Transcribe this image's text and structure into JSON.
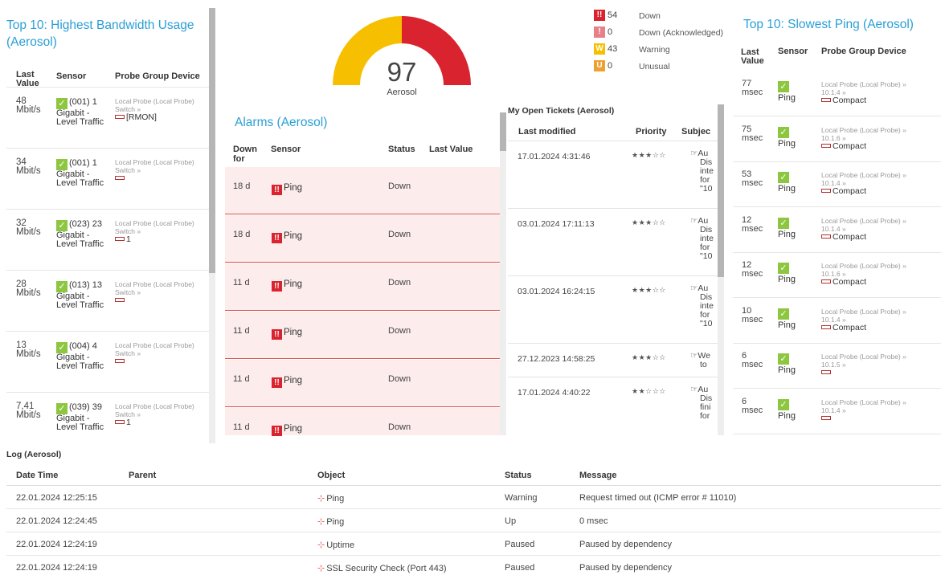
{
  "bandwidth": {
    "title": "Top 10: Highest Bandwidth Usage (Aerosol)",
    "headers": {
      "value": "Last Value",
      "sensor": "Sensor",
      "device": "Probe Group Device"
    },
    "rows": [
      {
        "value": "48 Mbit/s",
        "sensor": "(001) 1 Gigabit - Level Traffic",
        "probe": "Local Probe (Local Probe)",
        "group": "Switch »",
        "device": "[RMON]"
      },
      {
        "value": "34 Mbit/s",
        "sensor": "(001) 1 Gigabit - Level Traffic",
        "probe": "Local Probe (Local Probe)",
        "group": "Switch »",
        "device": ""
      },
      {
        "value": "32 Mbit/s",
        "sensor": "(023) 23 Gigabit - Level Traffic",
        "probe": "Local Probe (Local Probe)",
        "group": "Switch »",
        "device": "1"
      },
      {
        "value": "28 Mbit/s",
        "sensor": "(013) 13 Gigabit - Level Traffic",
        "probe": "Local Probe (Local Probe)",
        "group": "Switch »",
        "device": ""
      },
      {
        "value": "13 Mbit/s",
        "sensor": "(004) 4 Gigabit - Level Traffic",
        "probe": "Local Probe (Local Probe)",
        "group": "Switch »",
        "device": ""
      },
      {
        "value": "7,41 Mbit/s",
        "sensor": "(039) 39 Gigabit - Level Traffic",
        "probe": "Local Probe (Local Probe)",
        "group": "Switch »",
        "device": "1"
      }
    ]
  },
  "gauge": {
    "value": "97",
    "label": "Aerosol",
    "fraction": 0.5,
    "colors": {
      "warn": "#f6c000",
      "down": "#d9232e"
    }
  },
  "status": [
    {
      "glyph": "!!",
      "count": "54",
      "label": "Down",
      "color": "#d9232e"
    },
    {
      "glyph": "!",
      "count": "0",
      "label": "Down (Acknowledged)",
      "color": "#e8808a"
    },
    {
      "glyph": "W",
      "count": "43",
      "label": "Warning",
      "color": "#f6c000"
    },
    {
      "glyph": "U",
      "count": "0",
      "label": "Unusual",
      "color": "#f0a030"
    }
  ],
  "alarms": {
    "title": "Alarms (Aerosol)",
    "headers": {
      "down": "Down for",
      "sensor": "Sensor",
      "status": "Status",
      "last": "Last Value"
    },
    "rows": [
      {
        "down": "18 d",
        "sensor": "Ping",
        "status": "Down"
      },
      {
        "down": "18 d",
        "sensor": "Ping",
        "status": "Down"
      },
      {
        "down": "11 d",
        "sensor": "Ping",
        "status": "Down"
      },
      {
        "down": "11 d",
        "sensor": "Ping",
        "status": "Down"
      },
      {
        "down": "11 d",
        "sensor": "Ping",
        "status": "Down"
      },
      {
        "down": "11 d",
        "sensor": "Ping",
        "status": "Down"
      }
    ]
  },
  "tickets": {
    "title": "My Open Tickets (Aerosol)",
    "headers": {
      "modified": "Last modified",
      "priority": "Priority",
      "subject": "Subjec"
    },
    "rows": [
      {
        "modified": "17.01.2024 4:31:46",
        "stars": "★★★☆☆",
        "subject": [
          "Au",
          "Dis",
          "inte",
          "for",
          "\"10"
        ]
      },
      {
        "modified": "03.01.2024 17:11:13",
        "stars": "★★★☆☆",
        "subject": [
          "Au",
          "Dis",
          "inte",
          "for",
          "\"10"
        ]
      },
      {
        "modified": "03.01.2024 16:24:15",
        "stars": "★★★☆☆",
        "subject": [
          "Au",
          "Dis",
          "inte",
          "for",
          "\"10"
        ]
      },
      {
        "modified": "27.12.2023 14:58:25",
        "stars": "★★★☆☆",
        "subject": [
          "We",
          "to"
        ]
      },
      {
        "modified": "17.01.2024 4:40:22",
        "stars": "★★☆☆☆",
        "subject": [
          "Au",
          "Dis",
          "fini",
          "for"
        ]
      }
    ]
  },
  "ping": {
    "title": "Top 10: Slowest Ping (Aerosol)",
    "headers": {
      "value": "Last Value",
      "sensor": "Sensor",
      "device": "Probe Group Device"
    },
    "rows": [
      {
        "value": "77 msec",
        "sensor": "Ping",
        "probe": "Local Probe (Local Probe) »",
        "ip": "10.1.4 »",
        "device": "Compact"
      },
      {
        "value": "75 msec",
        "sensor": "Ping",
        "probe": "Local Probe (Local Probe) »",
        "ip": "10.1.6 »",
        "device": "Compact"
      },
      {
        "value": "53 msec",
        "sensor": "Ping",
        "probe": "Local Probe (Local Probe) »",
        "ip": "10.1.4 »",
        "device": "Compact"
      },
      {
        "value": "12 msec",
        "sensor": "Ping",
        "probe": "Local Probe (Local Probe) »",
        "ip": "10.1.4 »",
        "device": "Compact"
      },
      {
        "value": "12 msec",
        "sensor": "Ping",
        "probe": "Local Probe (Local Probe) »",
        "ip": "10.1.6 »",
        "device": "Compact"
      },
      {
        "value": "10 msec",
        "sensor": "Ping",
        "probe": "Local Probe (Local Probe) »",
        "ip": "10.1.4 »",
        "device": "Compact"
      },
      {
        "value": "6 msec",
        "sensor": "Ping",
        "probe": "Local Probe (Local Probe) »",
        "ip": "10.1.5 »",
        "device": ""
      },
      {
        "value": "6 msec",
        "sensor": "Ping",
        "probe": "Local Probe (Local Probe) »",
        "ip": "10.1.4 »",
        "device": ""
      }
    ]
  },
  "log": {
    "title": "Log (Aerosol)",
    "headers": {
      "datetime": "Date Time",
      "parent": "Parent",
      "object": "Object",
      "status": "Status",
      "message": "Message"
    },
    "rows": [
      {
        "datetime": "22.01.2024 12:25:15",
        "parent": "",
        "object": "Ping",
        "status": "Warning",
        "message": "Request timed out (ICMP error # 11010)"
      },
      {
        "datetime": "22.01.2024 12:24:45",
        "parent": "",
        "object": "Ping",
        "status": "Up",
        "message": "0 msec"
      },
      {
        "datetime": "22.01.2024 12:24:19",
        "parent": "",
        "object": "Uptime",
        "status": "Paused",
        "message": "Paused by dependency"
      },
      {
        "datetime": "22.01.2024 12:24:19",
        "parent": "",
        "object": "SSL Security Check (Port 443)",
        "status": "Paused",
        "message": "Paused by dependency"
      }
    ]
  }
}
